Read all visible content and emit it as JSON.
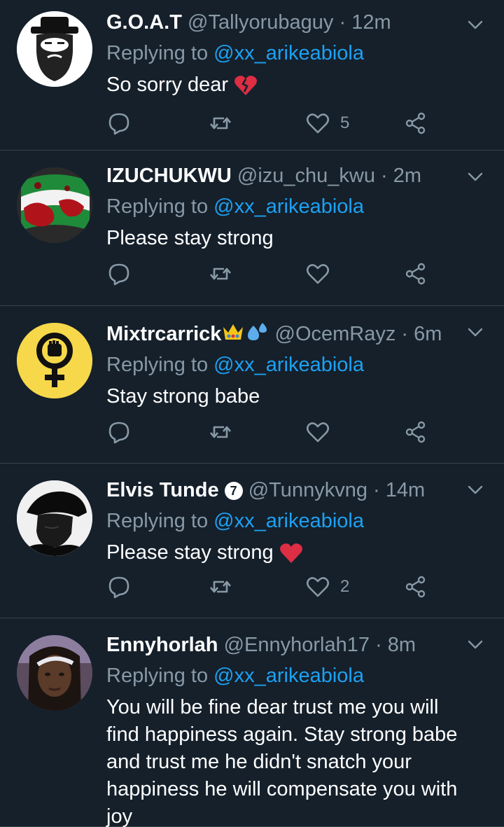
{
  "tweets": [
    {
      "name": "G.O.A.T",
      "handle": "@Tallyorubaguy",
      "separator": "·",
      "time": "12m",
      "reply_prefix": "Replying to",
      "reply_to": "@xx_arikeabiola",
      "text": "So sorry dear",
      "emoji": "broken-heart",
      "like_count": "5",
      "avatar": "bearded-man-hat-illustration"
    },
    {
      "name": "IZUCHUKWU",
      "handle": "@izu_chu_kwu",
      "separator": "·",
      "time": "2m",
      "reply_prefix": "Replying to",
      "reply_to": "@xx_arikeabiola",
      "text": "Please stay strong",
      "like_count": "",
      "avatar": "green-white-red-flag"
    },
    {
      "name": "Mixtrcarrick",
      "name_emojis": [
        "crown",
        "sweat-droplets"
      ],
      "handle": "@OcemRayz",
      "separator": "·",
      "time": "6m",
      "reply_prefix": "Replying to",
      "reply_to": "@xx_arikeabiola",
      "text": "Stay strong babe",
      "like_count": "",
      "avatar": "female-symbol-fist-yellow"
    },
    {
      "name": "Elvis Tunde",
      "name_badge": "7",
      "handle": "@Tunnykvng",
      "separator": "·",
      "time": "14m",
      "reply_prefix": "Replying to",
      "reply_to": "@xx_arikeabiola",
      "text": "Please stay strong",
      "emoji": "red-heart",
      "like_count": "2",
      "avatar": "man-black-cap-photo"
    },
    {
      "name": "Ennyhorlah",
      "handle": "@Ennyhorlah17",
      "separator": "·",
      "time": "8m",
      "reply_prefix": "Replying to",
      "reply_to": "@xx_arikeabiola",
      "text": "You will be fine dear trust me you will find happiness again. Stay strong babe and trust me he didn't snatch your happiness he will compensate you with joy",
      "avatar": "woman-selfie-photo"
    }
  ],
  "colors": {
    "background": "#15202b",
    "divider": "#38444d",
    "secondary_text": "#8899a6",
    "accent": "#1da1f2"
  }
}
